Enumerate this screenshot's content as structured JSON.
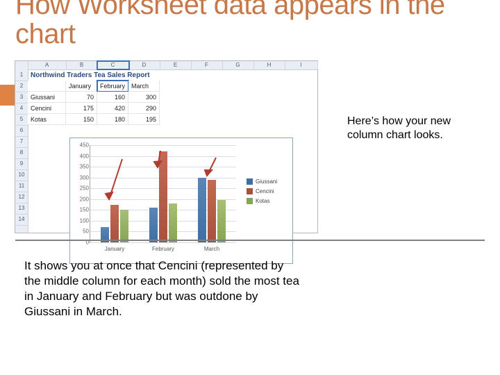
{
  "title": "How Worksheet data appears in the chart",
  "caption": "Here’s how your new column chart looks.",
  "body_text": "It shows you at once that Cencini (represented by the middle column for each month) sold the most tea in January and February but was outdone by Giussani in March.",
  "spreadsheet_title": "Northwind Traders Tea Sales Report",
  "col_letters": [
    "A",
    "B",
    "C",
    "D",
    "E",
    "F",
    "G",
    "H",
    "I"
  ],
  "row_numbers": [
    "1",
    "2",
    "3",
    "4",
    "5",
    "6",
    "7",
    "8",
    "9",
    "10",
    "11",
    "12",
    "13",
    "14"
  ],
  "month_headers": [
    "January",
    "February",
    "March"
  ],
  "rows": [
    {
      "name": "Giussani",
      "vals": [
        "70",
        "160",
        "300"
      ]
    },
    {
      "name": "Cencini",
      "vals": [
        "175",
        "420",
        "290"
      ]
    },
    {
      "name": "Kotas",
      "vals": [
        "150",
        "180",
        "195"
      ]
    }
  ],
  "chart_data": {
    "type": "bar",
    "categories": [
      "January",
      "February",
      "March"
    ],
    "series": [
      {
        "name": "Giussani",
        "values": [
          70,
          160,
          300
        ]
      },
      {
        "name": "Cencini",
        "values": [
          175,
          420,
          290
        ]
      },
      {
        "name": "Kotas",
        "values": [
          150,
          180,
          195
        ]
      }
    ],
    "ylim": [
      0,
      450
    ],
    "yticks": [
      0,
      50,
      100,
      150,
      200,
      250,
      300,
      350,
      400,
      450
    ],
    "xlabel": "",
    "ylabel": "",
    "title": ""
  },
  "legend_labels": [
    "Giussani",
    "Cencini",
    "Kotas"
  ]
}
